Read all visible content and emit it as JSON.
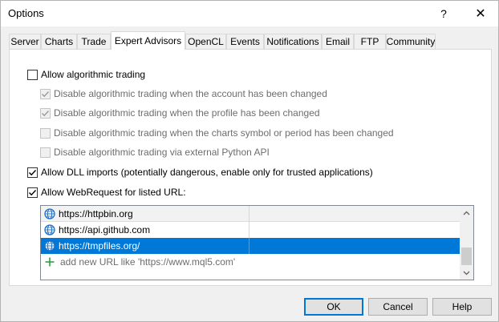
{
  "window": {
    "title": "Options",
    "help_label": "?",
    "close_label": "✕"
  },
  "tabs": [
    {
      "label": "Server"
    },
    {
      "label": "Charts"
    },
    {
      "label": "Trade"
    },
    {
      "label": "Expert Advisors",
      "active": true
    },
    {
      "label": "OpenCL"
    },
    {
      "label": "Events"
    },
    {
      "label": "Notifications"
    },
    {
      "label": "Email"
    },
    {
      "label": "FTP"
    },
    {
      "label": "Community"
    }
  ],
  "options": {
    "allow_algo": {
      "label": "Allow algorithmic trading",
      "checked": false
    },
    "disable_account": {
      "label": "Disable algorithmic trading when the account has been changed",
      "checked": true,
      "enabled": false
    },
    "disable_profile": {
      "label": "Disable algorithmic trading when the profile has been changed",
      "checked": true,
      "enabled": false
    },
    "disable_symbol": {
      "label": "Disable algorithmic trading when the charts symbol or period has been changed",
      "checked": false,
      "enabled": false
    },
    "disable_python": {
      "label": "Disable algorithmic trading via external Python API",
      "checked": false,
      "enabled": false
    },
    "allow_dll": {
      "label": "Allow DLL imports (potentially dangerous, enable only for trusted applications)",
      "checked": true
    },
    "allow_webrequest": {
      "label": "Allow WebRequest for listed URL:",
      "checked": true
    }
  },
  "url_list": {
    "urls": [
      {
        "url": "https://httpbin.org"
      },
      {
        "url": "https://api.github.com"
      },
      {
        "url": "https://tmpfiles.org/",
        "selected": true
      }
    ],
    "add_placeholder": "add new URL like 'https://www.mql5.com'"
  },
  "buttons": {
    "ok": "OK",
    "cancel": "Cancel",
    "help": "Help"
  },
  "colors": {
    "selection": "#0078d7",
    "globe": "#1e73c8",
    "plus": "#2ea043"
  }
}
